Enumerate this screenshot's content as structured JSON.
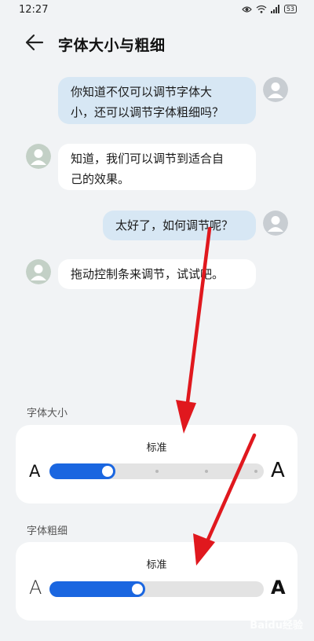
{
  "status": {
    "time": "12:27",
    "battery": "53",
    "icons": [
      "eye-icon",
      "wifi-icon",
      "signal-icon",
      "battery-icon"
    ]
  },
  "header": {
    "back_icon": "back-arrow-icon",
    "title": "字体大小与粗细"
  },
  "chat": [
    {
      "side": "right",
      "line1": "你知道不仅可以调节字体大",
      "line2": "小，还可以调节字体粗细吗？"
    },
    {
      "side": "left",
      "line1": "知道，我们可以调节到适合自",
      "line2": "己的效果。"
    },
    {
      "side": "right",
      "line1": "太好了，如何调节呢？"
    },
    {
      "side": "left",
      "line1": "拖动控制条来调节，试试吧。"
    }
  ],
  "font_size": {
    "label": "字体大小",
    "level": "标准",
    "small_letter": "A",
    "large_letter": "A",
    "value_fraction": 0.27,
    "stops": 5
  },
  "font_weight": {
    "label": "字体粗细",
    "level": "标准",
    "light_letter": "A",
    "bold_letter": "A",
    "value_fraction": 0.41
  },
  "colors": {
    "accent": "#1a66e0",
    "annotation_arrow": "#e0181e",
    "outgoing_bubble": "#d7e7f4"
  },
  "watermark": "Baidu经验"
}
